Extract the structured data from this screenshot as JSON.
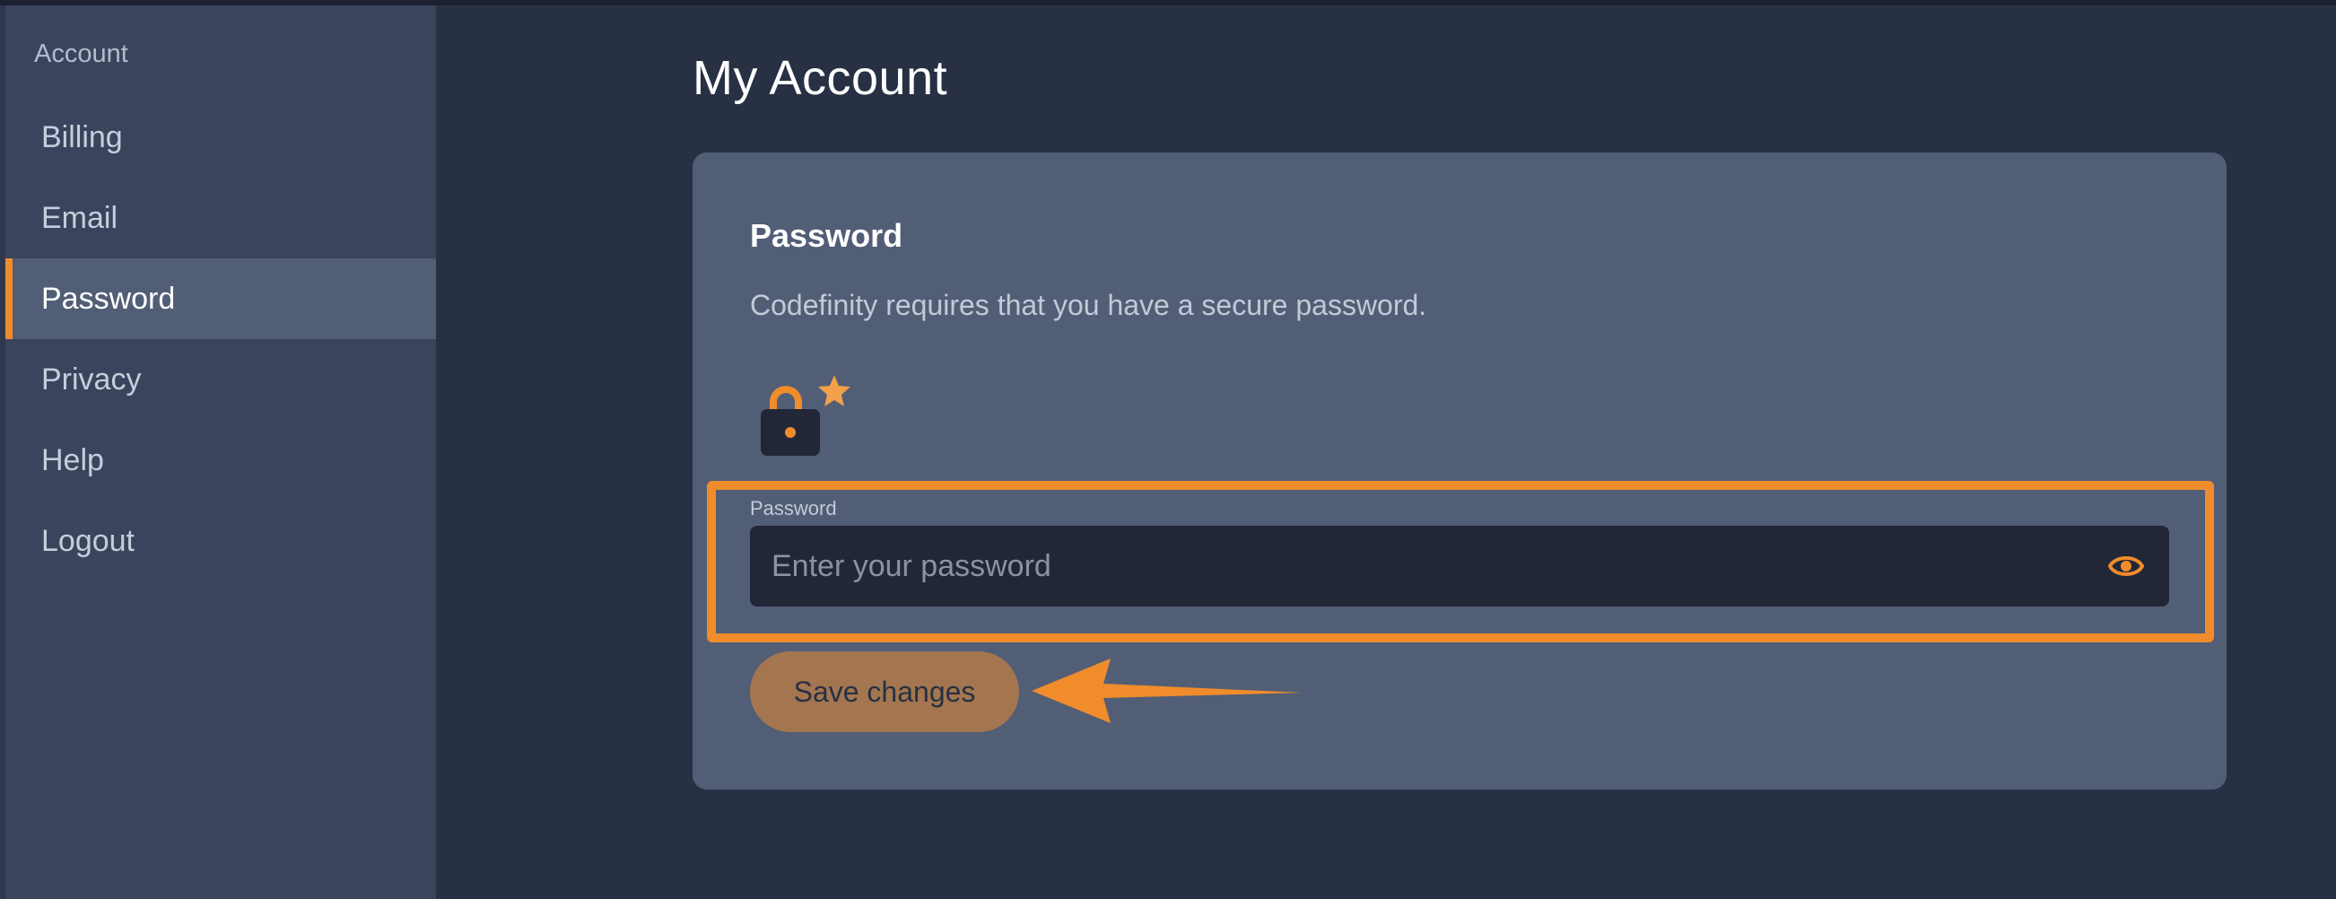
{
  "sidebar": {
    "header": "Account",
    "items": [
      {
        "label": "Billing"
      },
      {
        "label": "Email"
      },
      {
        "label": "Password"
      },
      {
        "label": "Privacy"
      },
      {
        "label": "Help"
      },
      {
        "label": "Logout"
      }
    ],
    "active_item": "Password"
  },
  "main": {
    "title": "My Account",
    "card": {
      "title": "Password",
      "description": "Codefinity requires that you have a secure password.",
      "icon": "lock-star-icon",
      "field": {
        "label": "Password",
        "placeholder": "Enter your password",
        "value": "",
        "toggle_icon": "eye-icon"
      },
      "save_label": "Save changes"
    }
  },
  "colors": {
    "background": "#283044",
    "sidebar": "#3a455d",
    "card": "#525e76",
    "accent": "#f08c2c",
    "input": "#222737",
    "save_button": "#a4764f"
  }
}
